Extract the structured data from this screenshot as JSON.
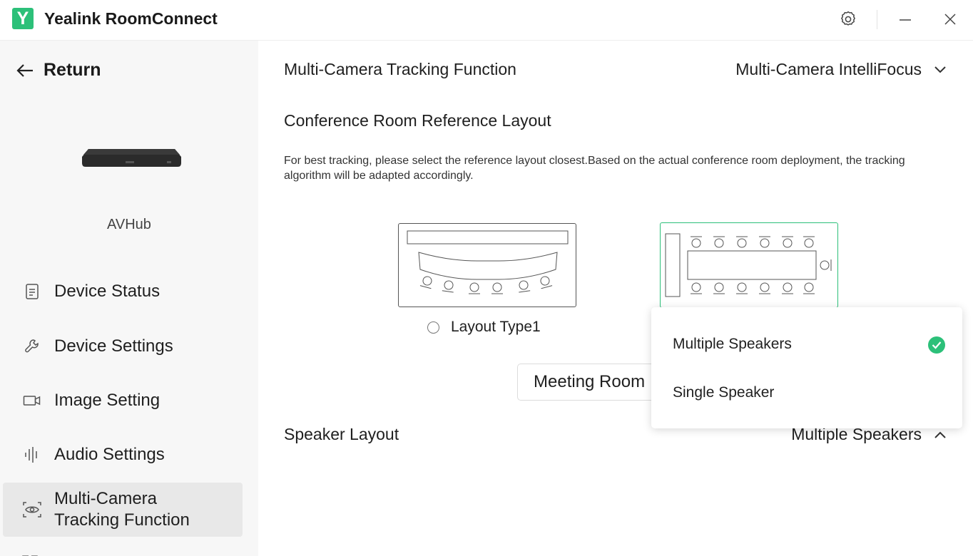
{
  "app": {
    "logo_letter": "Y",
    "title": "Yealink RoomConnect"
  },
  "titlebar": {
    "icons": [
      "gear-icon",
      "minimize-icon",
      "close-icon"
    ]
  },
  "sidebar": {
    "return_label": "Return",
    "device_name": "AVHub",
    "items": [
      {
        "label": "Device Status",
        "icon": "document-icon"
      },
      {
        "label": "Device Settings",
        "icon": "wrench-icon"
      },
      {
        "label": "Image Setting",
        "icon": "camera-icon"
      },
      {
        "label": "Audio Settings",
        "icon": "audio-wave-icon"
      },
      {
        "label_line1": "Multi-Camera",
        "label_line2": "Tracking Function",
        "icon": "eye-scan-icon",
        "active": true
      }
    ]
  },
  "main": {
    "tracking_function": {
      "label": "Multi-Camera Tracking Function",
      "value": "Multi-Camera IntelliFocus"
    },
    "reference_layout": {
      "heading": "Conference Room Reference Layout",
      "description": "For best tracking, please select the reference layout closest.Based on the actual conference room deployment, the tracking algorithm will be adapted accordingly.",
      "layouts": [
        {
          "label": "Layout Type1",
          "selected": false
        },
        {
          "label": "",
          "selected": true
        }
      ]
    },
    "room_select": {
      "value": "Meeting Room"
    },
    "speaker_layout": {
      "label": "Speaker Layout",
      "value": "Multiple Speakers"
    }
  },
  "dropdown": {
    "options": [
      {
        "label": "Multiple Speakers",
        "selected": true
      },
      {
        "label": "Single Speaker",
        "selected": false
      }
    ]
  },
  "colors": {
    "accent": "#2cc079",
    "sidebar_bg": "#f7f7f7",
    "active_item_bg": "#e8e8e8"
  }
}
